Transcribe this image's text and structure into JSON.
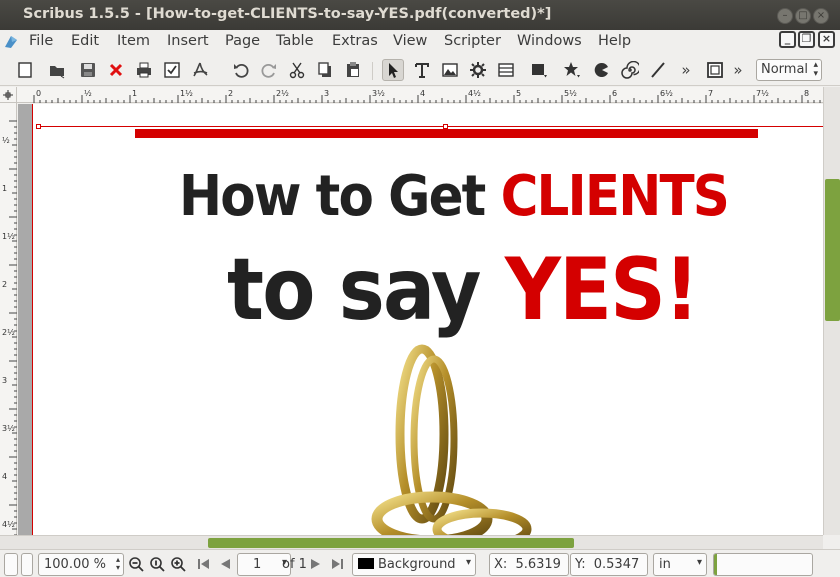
{
  "window": {
    "title": "Scribus 1.5.5 - [How-to-get-CLIENTS-to-say-YES.pdf(converted)*]"
  },
  "menu": {
    "items": [
      {
        "label": "File"
      },
      {
        "label": "Edit"
      },
      {
        "label": "Item"
      },
      {
        "label": "Insert"
      },
      {
        "label": "Page"
      },
      {
        "label": "Table"
      },
      {
        "label": "Extras"
      },
      {
        "label": "View"
      },
      {
        "label": "Scripter"
      },
      {
        "label": "Windows"
      },
      {
        "label": "Help"
      }
    ]
  },
  "toolbar": {
    "more_label": "»",
    "more_label_2": "»",
    "mode_value": "Normal"
  },
  "ruler": {
    "top_ticks": [
      "0",
      "½",
      "1",
      "1½",
      "2",
      "2½",
      "3",
      "3½",
      "4",
      "4½",
      "5",
      "5½",
      "6",
      "6½",
      "7",
      "7½",
      "8"
    ],
    "left_ticks": [
      "½",
      "1",
      "1½",
      "2",
      "2½",
      "3",
      "3½",
      "4",
      "4½"
    ]
  },
  "document": {
    "line1_black": "How to Get ",
    "line1_red": "CLIENTS",
    "line2_black": "to say ",
    "line2_red": "YES!",
    "accent_color": "#d40000",
    "text_color": "#222222"
  },
  "statusbar": {
    "zoom_value": "100.00 %",
    "page_value": "1",
    "page_of": "of 1",
    "layer_value": "Background",
    "x_label": "X:",
    "x_value": "5.6319",
    "y_label": "Y:",
    "y_value": "0.5347",
    "unit_value": "in"
  }
}
